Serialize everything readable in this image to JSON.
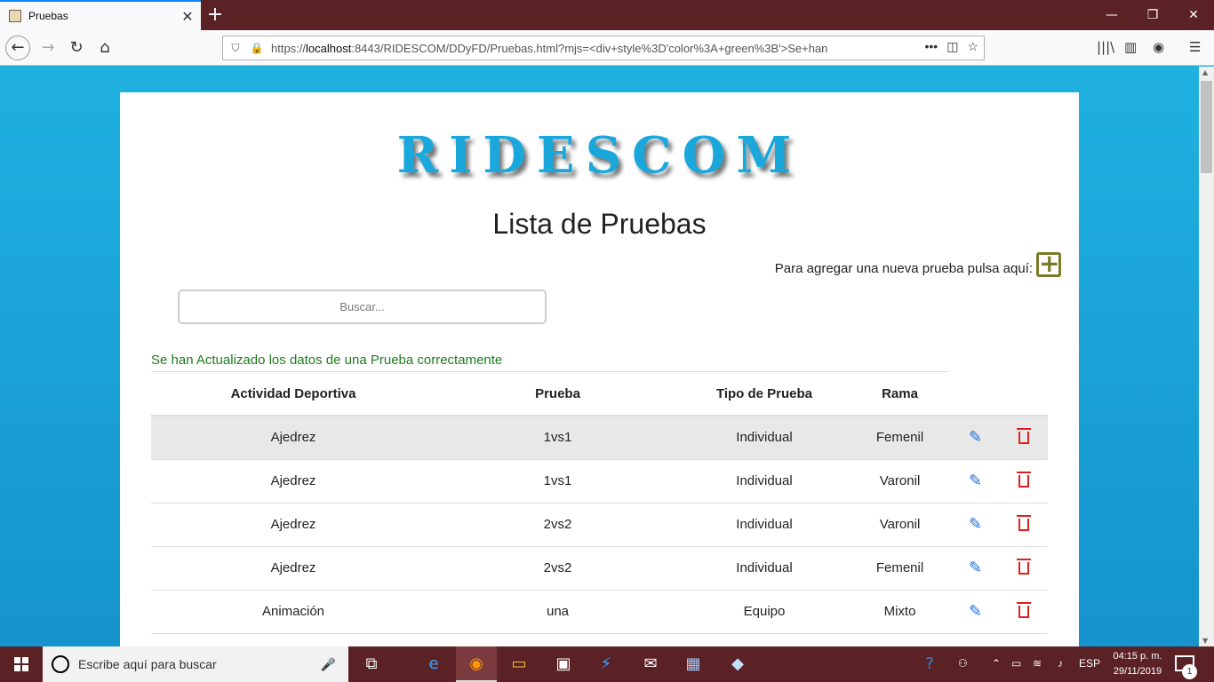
{
  "browser": {
    "tab_title": "Pruebas",
    "tab_close": "✕",
    "new_tab": "+",
    "url_scheme": "https://",
    "url_host": "localhost",
    "url_rest": ":8443/RIDESCOM/DDyFD/Pruebas.html?mjs=<div+style%3D'color%3A+green%3B'>Se+han",
    "window_controls": [
      "—",
      "❐",
      "✕"
    ]
  },
  "page": {
    "brand": "RIDESCOM",
    "title": "Lista de Pruebas",
    "add_text": "Para agregar una nueva prueba pulsa aquí:",
    "add_button": "+",
    "search_placeholder": "Buscar...",
    "success_message": "Se han Actualizado los datos de una Prueba correctamente"
  },
  "table": {
    "headers": [
      "Actividad Deportiva",
      "Prueba",
      "Tipo de Prueba",
      "Rama"
    ],
    "rows": [
      [
        "Ajedrez",
        "1vs1",
        "Individual",
        "Femenil"
      ],
      [
        "Ajedrez",
        "1vs1",
        "Individual",
        "Varonil"
      ],
      [
        "Ajedrez",
        "2vs2",
        "Individual",
        "Varonil"
      ],
      [
        "Ajedrez",
        "2vs2",
        "Individual",
        "Femenil"
      ],
      [
        "Animación",
        "una",
        "Equipo",
        "Mixto"
      ]
    ]
  },
  "taskbar": {
    "search_placeholder": "Escribe aquí para buscar",
    "language": "ESP",
    "time": "04:15 p. m.",
    "date": "29/11/2019",
    "notification_count": "1"
  },
  "colors": {
    "brand": "#1aa8dc",
    "success": "#1f7a1f",
    "edit": "#1e6fd9",
    "delete": "#e02020",
    "titlebar": "#5b2226"
  }
}
